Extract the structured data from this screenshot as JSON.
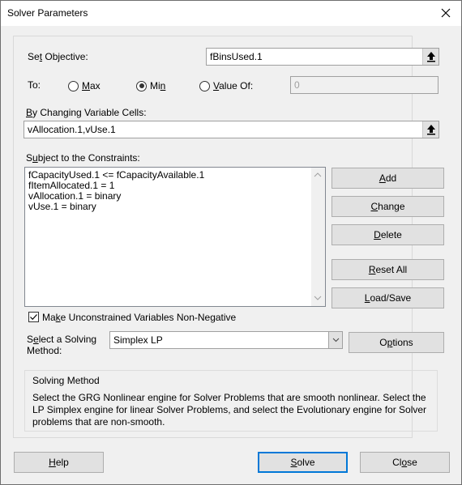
{
  "window": {
    "title": "Solver Parameters"
  },
  "objective": {
    "label_pre": "Se",
    "label_ul": "t",
    "label_post": " Objective:",
    "value": "fBinsUsed.1"
  },
  "to": {
    "label": "To:",
    "options": [
      {
        "pre": "",
        "ul": "M",
        "post": "ax",
        "selected": false
      },
      {
        "pre": "Mi",
        "ul": "n",
        "post": "",
        "selected": true
      },
      {
        "pre": "",
        "ul": "V",
        "post": "alue Of:",
        "selected": false
      }
    ],
    "value_of": "0"
  },
  "changing_cells": {
    "label_pre": "",
    "label_ul": "B",
    "label_post": "y Changing Variable Cells:",
    "value": "vAllocation.1,vUse.1"
  },
  "constraints": {
    "label_pre": "S",
    "label_ul": "u",
    "label_post": "bject to the Constraints:",
    "items": [
      "fCapacityUsed.1 <= fCapacityAvailable.1",
      "fItemAllocated.1 = 1",
      "vAllocation.1 = binary",
      "vUse.1 = binary"
    ]
  },
  "buttons": {
    "add": {
      "ul": "A",
      "post": "dd"
    },
    "change": {
      "ul": "C",
      "post": "hange"
    },
    "delete": {
      "ul": "D",
      "post": "elete"
    },
    "reset_all": {
      "ul": "R",
      "post": "eset All"
    },
    "load_save": {
      "ul": "L",
      "post": "oad/Save"
    },
    "options": {
      "pre": "O",
      "ul": "p",
      "post": "tions"
    },
    "help": {
      "ul": "H",
      "post": "elp"
    },
    "solve": {
      "ul": "S",
      "post": "olve"
    },
    "close": {
      "pre": "Cl",
      "ul": "o",
      "post": "se"
    }
  },
  "nonnegative": {
    "pre": "Ma",
    "ul": "k",
    "post": "e Unconstrained Variables Non-Negative",
    "checked": true
  },
  "method": {
    "label_pre": "S",
    "label_ul": "e",
    "label_post": "lect a Solving",
    "label_line2": "Method:",
    "selected": "Simplex LP"
  },
  "info": {
    "heading": "Solving Method",
    "text": "Select the GRG Nonlinear engine for Solver Problems that are smooth nonlinear. Select the LP Simplex engine for linear Solver Problems, and select the Evolutionary engine for Solver problems that are non-smooth."
  },
  "icons": {
    "close": "close-icon",
    "collapse": "collapse-dialog-icon",
    "dropdown": "chevron-down-icon",
    "check": "checkmark-icon"
  }
}
